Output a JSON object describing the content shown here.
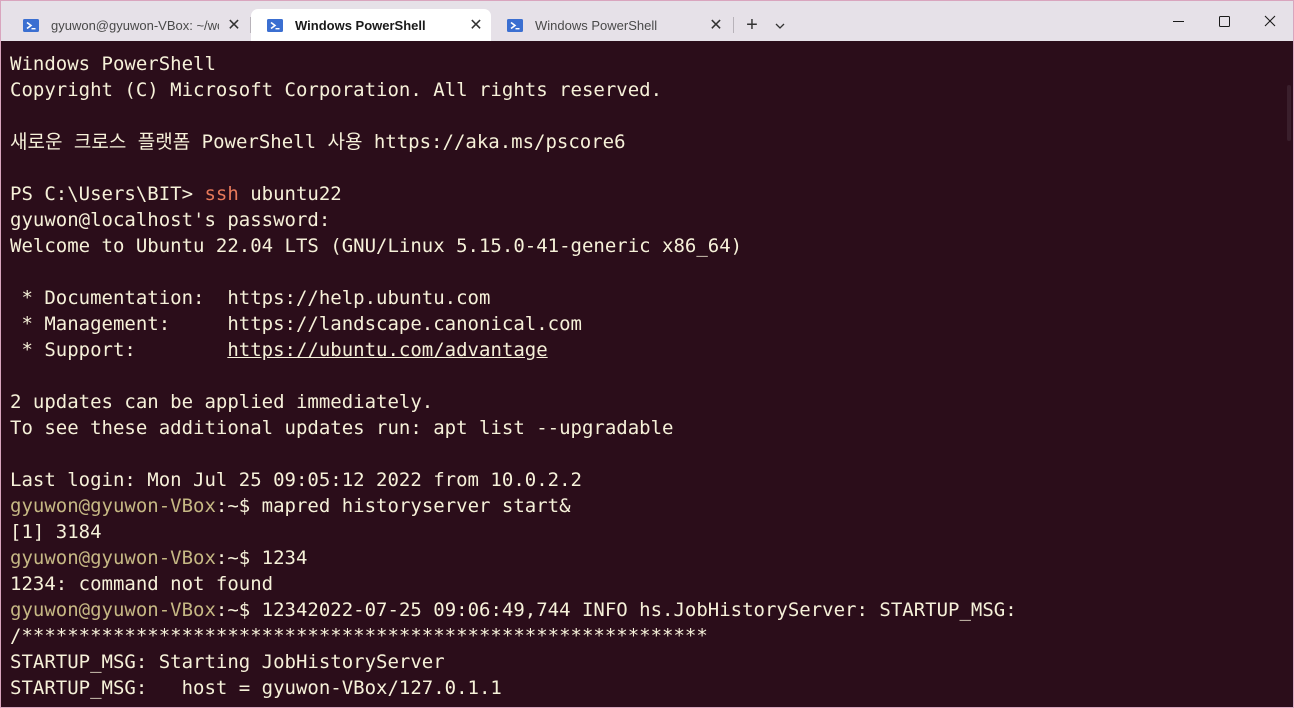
{
  "tabs": [
    {
      "title": "gyuwon@gyuwon-VBox: ~/wc",
      "active": false
    },
    {
      "title": "Windows PowerShell",
      "active": true
    },
    {
      "title": "Windows PowerShell",
      "active": false
    }
  ],
  "controls": {
    "new_tab": "+",
    "dropdown": "⌄"
  },
  "window_controls": {
    "minimize": "minimize",
    "maximize": "maximize",
    "close": "close"
  },
  "terminal": {
    "l01": "Windows PowerShell",
    "l02": "Copyright (C) Microsoft Corporation. All rights reserved.",
    "l03": "",
    "l04": "새로운 크로스 플랫폼 PowerShell 사용 https://aka.ms/pscore6",
    "l05": "",
    "l06_prompt": "PS C:\\Users\\BIT> ",
    "l06_cmd": "ssh",
    "l06_arg": " ubuntu22",
    "l07": "gyuwon@localhost's password:",
    "l08": "Welcome to Ubuntu 22.04 LTS (GNU/Linux 5.15.0-41-generic x86_64)",
    "l09": "",
    "l10": " * Documentation:  https://help.ubuntu.com",
    "l11": " * Management:     https://landscape.canonical.com",
    "l12_label": " * Support:        ",
    "l12_link": "https://ubuntu.com/advantage",
    "l13": "",
    "l14": "2 updates can be applied immediately.",
    "l15": "To see these additional updates run: apt list --upgradable",
    "l16": "",
    "l17": "Last login: Mon Jul 25 09:05:12 2022 from 10.0.2.2",
    "l18_prompt": "gyuwon@gyuwon-VBox",
    "l18_path": ":~$ ",
    "l18_cmd": "mapred historyserver start&",
    "l19": "[1] 3184",
    "l20_prompt": "gyuwon@gyuwon-VBox",
    "l20_path": ":~$ ",
    "l20_cmd": "1234",
    "l21": "1234: command not found",
    "l22_prompt": "gyuwon@gyuwon-VBox",
    "l22_path": ":~$ ",
    "l22_cmd": "12342022-07-25 09:06:49,744 INFO hs.JobHistoryServer: STARTUP_MSG:",
    "l23": "/************************************************************",
    "l24": "STARTUP_MSG: Starting JobHistoryServer",
    "l25": "STARTUP_MSG:   host = gyuwon-VBox/127.0.1.1"
  },
  "colors": {
    "terminal_bg": "#2b0d1a",
    "text": "#f6f1d9",
    "prompt_user": "#c6b884",
    "ssh_cmd": "#e8795a"
  }
}
